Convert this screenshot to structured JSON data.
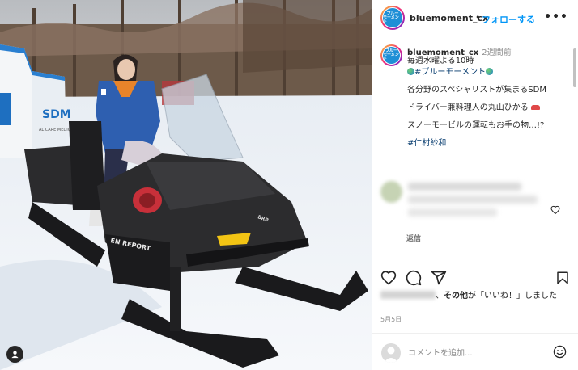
{
  "post": {
    "username": "bluemoment_cx",
    "separator": "•",
    "follow_label": "フォローする",
    "more_icon": "more-horizontal-icon",
    "avatar_text_line1": "ブルー",
    "avatar_text_line2": "モーメント"
  },
  "caption": {
    "username": "bluemoment_cx",
    "time": "2週間前",
    "line1": "毎週水曜よる10時",
    "hashtag_program": "#ブルーモーメント",
    "line_sdm": "各分野のスペシャリストが集まるSDM",
    "line_driver": "ドライバー兼料理人の丸山ひかる",
    "line_snowmobile": "スノーモービルの運転もお手の物…!?",
    "hashtag_actor": "#仁村紗和"
  },
  "comment": {
    "reply_label": "返信"
  },
  "actions": {
    "like_icon": "heart-icon",
    "comment_icon": "comment-icon",
    "share_icon": "share-icon",
    "save_icon": "bookmark-icon"
  },
  "likes": {
    "text_bold": "その他",
    "text_rest": "が「いいね！」しました"
  },
  "date": "5月5日",
  "comment_input": {
    "placeholder": "コメントを追加..."
  },
  "photo": {
    "tent_text": "SDM",
    "tent_subtext": "AL CARE MEDIC",
    "sled_brand": "EN REPORT",
    "sled_badge": "BRP"
  },
  "colors": {
    "accent": "#0095f6",
    "hashtag": "#00376b"
  }
}
